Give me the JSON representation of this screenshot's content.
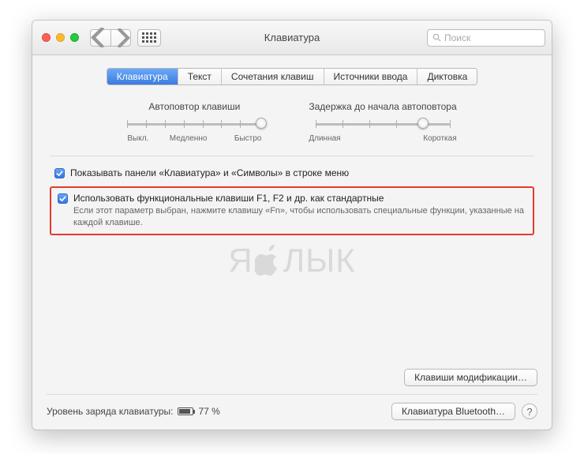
{
  "window": {
    "title": "Клавиатура"
  },
  "search": {
    "placeholder": "Поиск"
  },
  "tabs": [
    "Клавиатура",
    "Текст",
    "Сочетания клавиш",
    "Источники ввода",
    "Диктовка"
  ],
  "sliders": {
    "repeat": {
      "title": "Автоповтор клавиши",
      "left": "Выкл.",
      "mid": "Медленно",
      "right": "Быстро"
    },
    "delay": {
      "title": "Задержка до начала автоповтора",
      "left": "Длинная",
      "right": "Короткая"
    }
  },
  "checks": {
    "showPanels": "Показывать панели «Клавиатура» и «Символы» в строке меню",
    "fnKeys": {
      "label": "Использовать функциональные клавиши F1, F2 и др. как стандартные",
      "desc": "Если этот параметр выбран, нажмите клавишу «Fn», чтобы использовать специальные функции, указанные на каждой клавише."
    }
  },
  "buttons": {
    "modifier": "Клавиши модификации…",
    "bluetooth": "Клавиатура Bluetooth…"
  },
  "battery": {
    "label": "Уровень заряда клавиатуры:",
    "value": "77 %"
  },
  "watermark": {
    "left": "Я",
    "right": "ЛЫК"
  }
}
